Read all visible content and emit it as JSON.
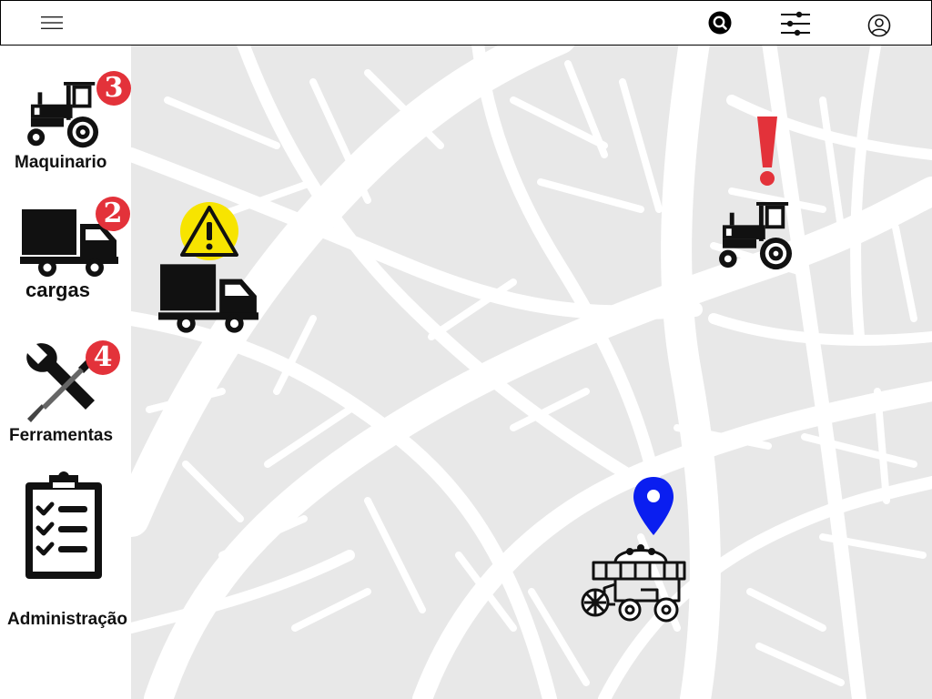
{
  "header": {
    "menu_icon": "hamburger-menu-icon",
    "search_icon": "search-icon",
    "filter_icon": "sliders-filter-icon",
    "user_icon": "user-profile-icon"
  },
  "sidebar": {
    "items": [
      {
        "label": "Maquinario",
        "icon": "tractor-icon",
        "badge": "3"
      },
      {
        "label": "cargas",
        "icon": "truck-icon",
        "badge": "2"
      },
      {
        "label": "Ferramentas",
        "icon": "wrench-screwdriver-icon",
        "badge": "4"
      },
      {
        "label": "Administração",
        "icon": "clipboard-checklist-icon"
      }
    ]
  },
  "map": {
    "markers": [
      {
        "type": "truck",
        "status": "warning",
        "icon": "warning-triangle-icon"
      },
      {
        "type": "tractor",
        "status": "alert",
        "icon": "exclamation-icon"
      },
      {
        "type": "harvester",
        "status": "location",
        "icon": "location-pin-icon"
      }
    ]
  },
  "colors": {
    "badge": "#e3323a",
    "warning": "#f7e400",
    "alert": "#e3323a",
    "pin": "#0a1ef0",
    "map_background": "#e8e8e8",
    "map_streets": "#ffffff"
  }
}
